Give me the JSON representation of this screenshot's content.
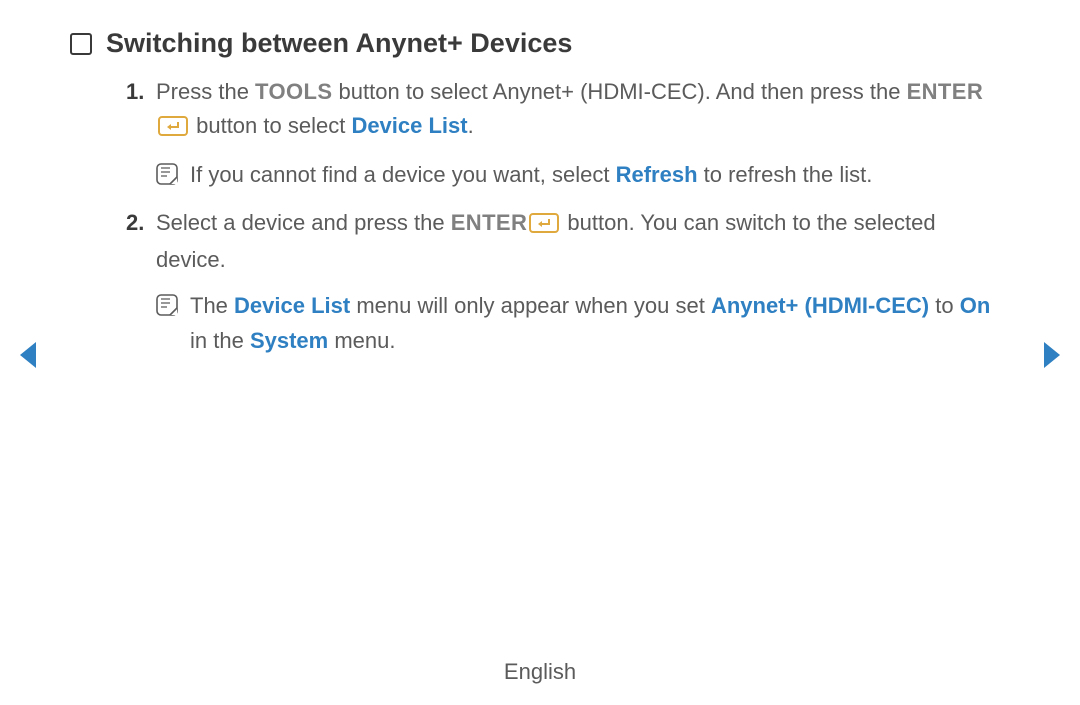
{
  "title": "Switching between Anynet+ Devices",
  "steps": {
    "s1_a": "Press the ",
    "s1_tools": "TOOLS",
    "s1_b": " button to select Anynet+ (HDMI-CEC). And then press the ",
    "s1_enter": "ENTER",
    "s1_c": " button to select ",
    "s1_devlist": "Device List",
    "s1_d": ".",
    "s1_note_a": "If you cannot find a device you want, select ",
    "s1_note_refresh": "Refresh",
    "s1_note_b": " to refresh the list.",
    "s2_a": "Select a device and press the ",
    "s2_enter": "ENTER",
    "s2_b": " button. You can switch to the selected device.",
    "s2_note_a": "The ",
    "s2_note_devlist": "Device List",
    "s2_note_b": " menu will only appear when you set ",
    "s2_note_anynet": "Anynet+ (HDMI-CEC)",
    "s2_note_c": " to ",
    "s2_note_on": "On",
    "s2_note_d": " in the ",
    "s2_note_system": "System",
    "s2_note_e": " menu."
  },
  "footer_language": "English"
}
